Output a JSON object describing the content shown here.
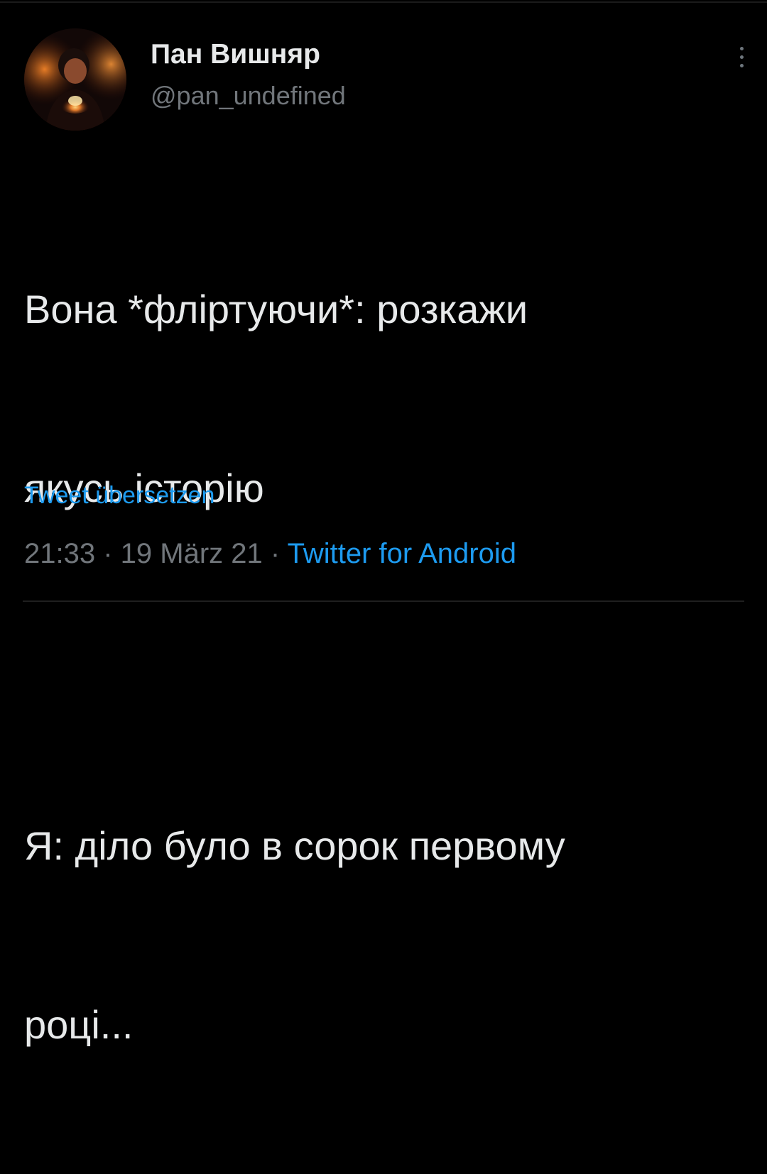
{
  "tweet": {
    "author": {
      "display_name": "Пан Вишняр",
      "handle": "@pan_undefined",
      "avatar": "profile-photo"
    },
    "text": {
      "paragraph_1_line_1": "Вона *фліртуючи*: розкажи",
      "paragraph_1_line_2": "якусь історію",
      "paragraph_2_line_1": "Я: діло було в сорок первому",
      "paragraph_2_line_2": "році..."
    },
    "translate_label": "Tweet übersetzen",
    "meta": {
      "time": "21:33",
      "separator_1": " · ",
      "date": "19 März 21",
      "separator_2": " · ",
      "source": "Twitter for Android"
    },
    "more_icon": "more-vertical-icon"
  },
  "colors": {
    "background": "#000000",
    "text_primary": "#e7e9ea",
    "text_secondary": "#71767b",
    "accent": "#1d9bf0"
  }
}
